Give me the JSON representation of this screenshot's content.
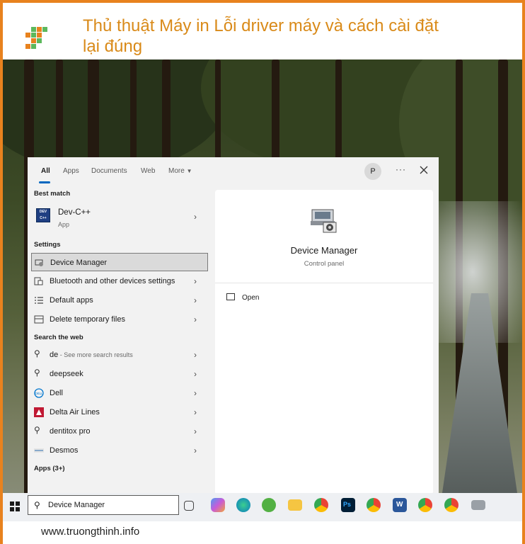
{
  "header": {
    "title": "Thủ thuật Máy in Lỗi driver máy và cách cài đặt lại đúng"
  },
  "search_panel": {
    "tabs": [
      "All",
      "Apps",
      "Documents",
      "Web",
      "More"
    ],
    "user_initial": "P",
    "more_dots": "···",
    "sections": {
      "best_match": "Best match",
      "settings": "Settings",
      "search_web": "Search the web",
      "apps_more": "Apps (3+)"
    },
    "best_match_item": {
      "name": "Dev-C++",
      "type": "App",
      "icon_text": "DEV C++"
    },
    "settings_items": [
      {
        "label": "Device Manager",
        "icon": "device-manager-icon"
      },
      {
        "label": "Bluetooth and other devices settings",
        "icon": "bluetooth-devices-icon"
      },
      {
        "label": "Default apps",
        "icon": "default-apps-icon"
      },
      {
        "label": "Delete temporary files",
        "icon": "delete-files-icon"
      }
    ],
    "web_items": [
      {
        "label": "de",
        "sub": " - See more search results",
        "icon": "search-icon"
      },
      {
        "label": "deepseek",
        "icon": "search-icon"
      },
      {
        "label": "Dell",
        "icon": "dell-icon"
      },
      {
        "label": "Delta Air Lines",
        "icon": "delta-icon"
      },
      {
        "label": "dentitox pro",
        "icon": "search-icon"
      },
      {
        "label": "Desmos",
        "icon": "desmos-icon"
      }
    ],
    "detail": {
      "name": "Device Manager",
      "subtitle": "Control panel",
      "open_label": "Open"
    }
  },
  "taskbar": {
    "search_value": "Device Manager",
    "apps": [
      "task-view",
      "copilot",
      "edge",
      "app-green",
      "file-explorer",
      "chrome",
      "photoshop",
      "chrome-profile",
      "word",
      "chrome-profile-2",
      "chrome-profile-3",
      "printer-app"
    ]
  },
  "footer": {
    "url": "www.truongthinh.info"
  },
  "colors": {
    "accent": "#e8821e",
    "title": "#d98a19",
    "selection": "#dadada",
    "windows_blue": "#0067c0"
  }
}
